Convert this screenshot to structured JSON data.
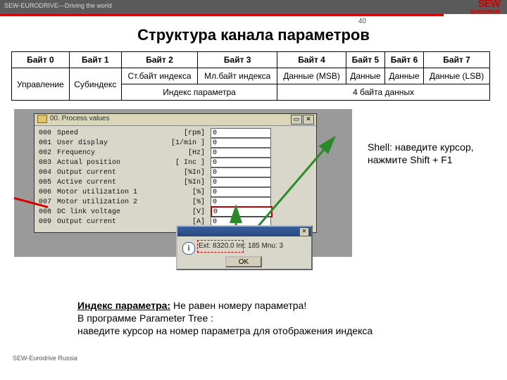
{
  "top": {
    "tag": "SEW-EURODRIVE—Driving the world",
    "logo": "SEW",
    "logo_sub": "EURODRIVE"
  },
  "page_number": "40",
  "title": "Структура канала параметров",
  "table": {
    "head": [
      "Байт 0",
      "Байт 1",
      "Байт 2",
      "Байт 3",
      "Байт 4",
      "Байт 5",
      "Байт 6",
      "Байт 7"
    ],
    "row1": [
      "Управление",
      "Субиндекс",
      "Ст.байт индекса",
      "Мл.байт индекса",
      "Данные (MSB)",
      "Данные",
      "Данные",
      "Данные (LSB)"
    ],
    "sub_left": "Индекс параметра",
    "sub_right": "4 байта данных"
  },
  "win": {
    "title": "00. Process values",
    "max": "▭",
    "close": "✕",
    "rows": [
      {
        "i": "000",
        "n": "Speed",
        "u": "[rpm]",
        "v": "0"
      },
      {
        "i": "001",
        "n": "User display",
        "u": "[1/min ]",
        "v": "0"
      },
      {
        "i": "002",
        "n": "Frequency",
        "u": "[Hz]",
        "v": "0"
      },
      {
        "i": "003",
        "n": "Actual position",
        "u": "[ Inc ]",
        "v": "0"
      },
      {
        "i": "004",
        "n": "Output current",
        "u": "[%In]",
        "v": "0"
      },
      {
        "i": "005",
        "n": "Active current",
        "u": "[%In]",
        "v": "0"
      },
      {
        "i": "006",
        "n": "Motor utilization 1",
        "u": "[%]",
        "v": "0"
      },
      {
        "i": "007",
        "n": "Motor utilization 2",
        "u": "[%]",
        "v": "0"
      },
      {
        "i": "008",
        "n": "DC link voltage",
        "u": "[V]",
        "v": "0"
      },
      {
        "i": "009",
        "n": "Output current",
        "u": "[A]",
        "v": "0"
      }
    ]
  },
  "dialog": {
    "info_glyph": "i",
    "msg": "Ext: 8320.0 Int: 185 Mnu: 3",
    "ok": "OK",
    "close": "✕"
  },
  "shell_note": "Shell: наведите курсор, нажмите Shift + F1",
  "bottom": {
    "lead": "Индекс параметра:",
    "rest1": " Не равен номеру параметра!",
    "line2": "В программе Parameter Tree :",
    "line3": "наведите курсор на номер параметра для отображения индекса"
  },
  "footer": "SEW-Eurodrive Russia"
}
